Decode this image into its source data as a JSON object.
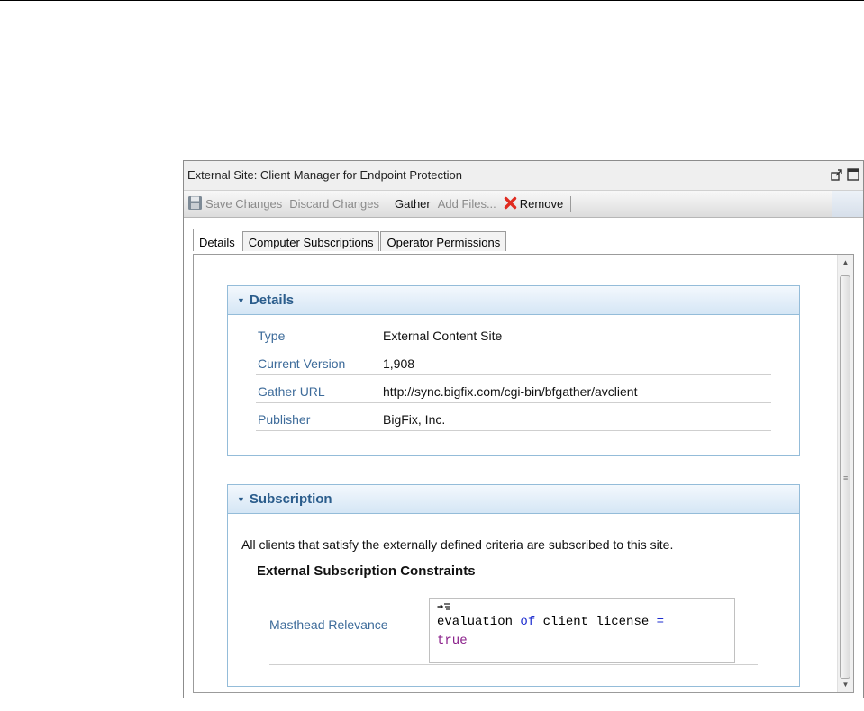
{
  "window": {
    "title": "External Site: Client Manager for Endpoint Protection",
    "pop_out_icon": "pop-out-icon",
    "maximize_icon": "maximize-icon"
  },
  "toolbar": {
    "save_label": "Save Changes",
    "discard_label": "Discard Changes",
    "gather_label": "Gather",
    "add_files_label": "Add Files...",
    "remove_label": "Remove",
    "save_icon": "floppy-disk-icon",
    "remove_icon": "red-x-icon"
  },
  "tabs": [
    {
      "label": "Details",
      "active": true
    },
    {
      "label": "Computer Subscriptions",
      "active": false
    },
    {
      "label": "Operator Permissions",
      "active": false
    }
  ],
  "details": {
    "header": "Details",
    "rows": [
      {
        "key": "Type",
        "value": "External Content Site"
      },
      {
        "key": "Current Version",
        "value": "1,908"
      },
      {
        "key": "Gather URL",
        "value": "http://sync.bigfix.com/cgi-bin/bfgather/avclient"
      },
      {
        "key": "Publisher",
        "value": "BigFix, Inc."
      }
    ]
  },
  "subscription": {
    "header": "Subscription",
    "text": "All clients that satisfy the externally defined criteria are subscribed to this site.",
    "constraints_heading": "External Subscription Constraints",
    "relevance_label": "Masthead Relevance",
    "code": {
      "line1_a": "evaluation",
      "line1_b": "of",
      "line1_c": "client license",
      "line1_d": "=",
      "line2": "true"
    }
  },
  "colors": {
    "section_border": "#94bcd9",
    "section_header_text": "#2b5d8c",
    "label_blue": "#3d6b9a",
    "keyword_blue": "#1c2ccf",
    "keyword_purple": "#8a1f8a",
    "remove_red": "#e02b20"
  }
}
